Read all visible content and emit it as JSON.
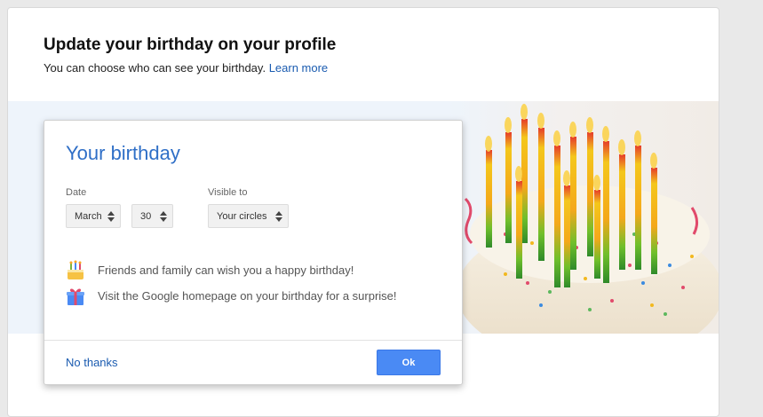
{
  "header": {
    "title": "Update your birthday on your profile",
    "subtitle": "You can choose who can see your birthday.",
    "learn_more": "Learn more"
  },
  "card": {
    "title": "Your birthday",
    "date_label": "Date",
    "month_value": "March",
    "day_value": "30",
    "visible_label": "Visible to",
    "visibility_value": "Your circles",
    "info": [
      {
        "icon": "cake-icon",
        "text": "Friends and family can wish you a happy birthday!"
      },
      {
        "icon": "gift-icon",
        "text": "Visit the Google homepage on your birthday for a surprise!"
      }
    ],
    "no_thanks": "No thanks",
    "ok": "Ok"
  },
  "colors": {
    "accent": "#4a8af4",
    "link": "#1a5bb0",
    "title_blue": "#2f6fc7"
  }
}
